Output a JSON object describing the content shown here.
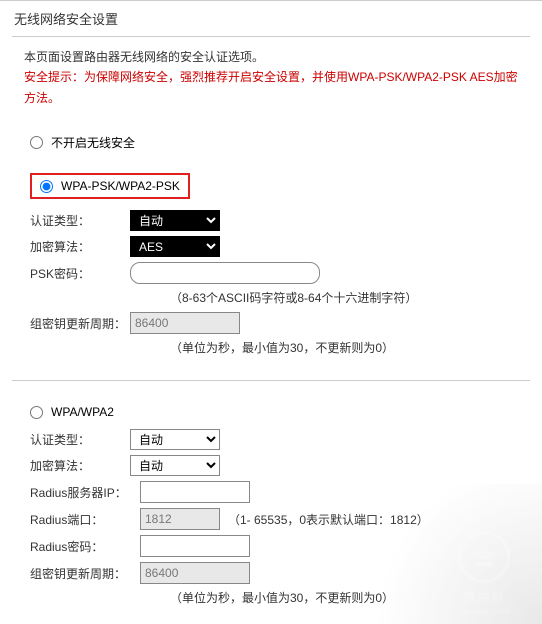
{
  "title": "无线网络安全设置",
  "intro_line": "本页面设置路由器无线网络的安全认证选项。",
  "tip_line": "安全提示：为保障网络安全，强烈推荐开启安全设置，并使用WPA-PSK/WPA2-PSK AES加密方法。",
  "option_none": {
    "label": "不开启无线安全"
  },
  "option_psk": {
    "label": "WPA-PSK/WPA2-PSK",
    "auth_label": "认证类型：",
    "auth_value": "自动",
    "enc_label": "加密算法：",
    "enc_value": "AES",
    "pwd_label": "PSK密码：",
    "pwd_value": "",
    "pwd_hint": "（8-63个ASCII码字符或8-64个十六进制字符）",
    "gk_label": "组密钥更新周期：",
    "gk_value": "86400",
    "gk_hint": "（单位为秒，最小值为30，不更新则为0）",
    "auth_options": [
      "自动"
    ],
    "enc_options": [
      "AES"
    ]
  },
  "option_wpa": {
    "label": "WPA/WPA2",
    "auth_label": "认证类型：",
    "auth_value": "自动",
    "enc_label": "加密算法：",
    "enc_value": "自动",
    "radius_ip_label": "Radius服务器IP：",
    "radius_ip_value": "",
    "radius_port_label": "Radius端口：",
    "radius_port_value": "1812",
    "radius_port_hint": "（1- 65535，0表示默认端口：1812）",
    "radius_pwd_label": "Radius密码：",
    "radius_pwd_value": "",
    "gk_label": "组密钥更新周期：",
    "gk_value": "86400",
    "gk_hint": "（单位为秒，最小值为30，不更新则为0）",
    "auth_options": [
      "自动"
    ],
    "enc_options": [
      "自动"
    ]
  },
  "watermark": {
    "brand": "路由器",
    "sub": "luyouqi.com"
  }
}
